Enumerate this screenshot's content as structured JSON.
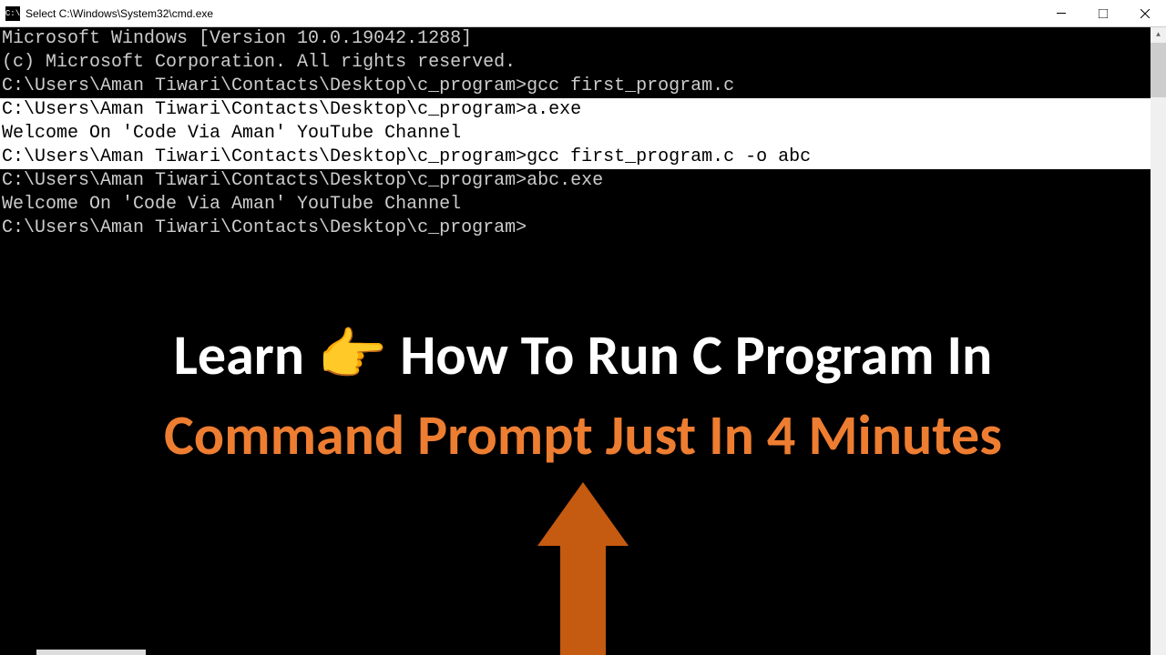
{
  "window": {
    "title": "Select C:\\Windows\\System32\\cmd.exe",
    "icon_label": "C:\\"
  },
  "terminal": {
    "lines_top": [
      "Microsoft Windows [Version 10.0.19042.1288]",
      "(c) Microsoft Corporation. All rights reserved.",
      "",
      "C:\\Users\\Aman Tiwari\\Contacts\\Desktop\\c_program>gcc first_program.c",
      ""
    ],
    "lines_highlight": [
      "C:\\Users\\Aman Tiwari\\Contacts\\Desktop\\c_program>a.exe",
      "Welcome On 'Code Via Aman' YouTube Channel",
      "C:\\Users\\Aman Tiwari\\Contacts\\Desktop\\c_program>gcc first_program.c -o abc"
    ],
    "lines_bottom": [
      "",
      "C:\\Users\\Aman Tiwari\\Contacts\\Desktop\\c_program>abc.exe",
      "Welcome On 'Code Via Aman' YouTube Channel",
      "C:\\Users\\Aman Tiwari\\Contacts\\Desktop\\c_program>"
    ]
  },
  "overlay": {
    "line1_prefix": "Learn ",
    "line1_emoji": "👉",
    "line1_suffix": " How To Run C Program In",
    "line2": "Command Prompt Just In 4 Minutes"
  }
}
